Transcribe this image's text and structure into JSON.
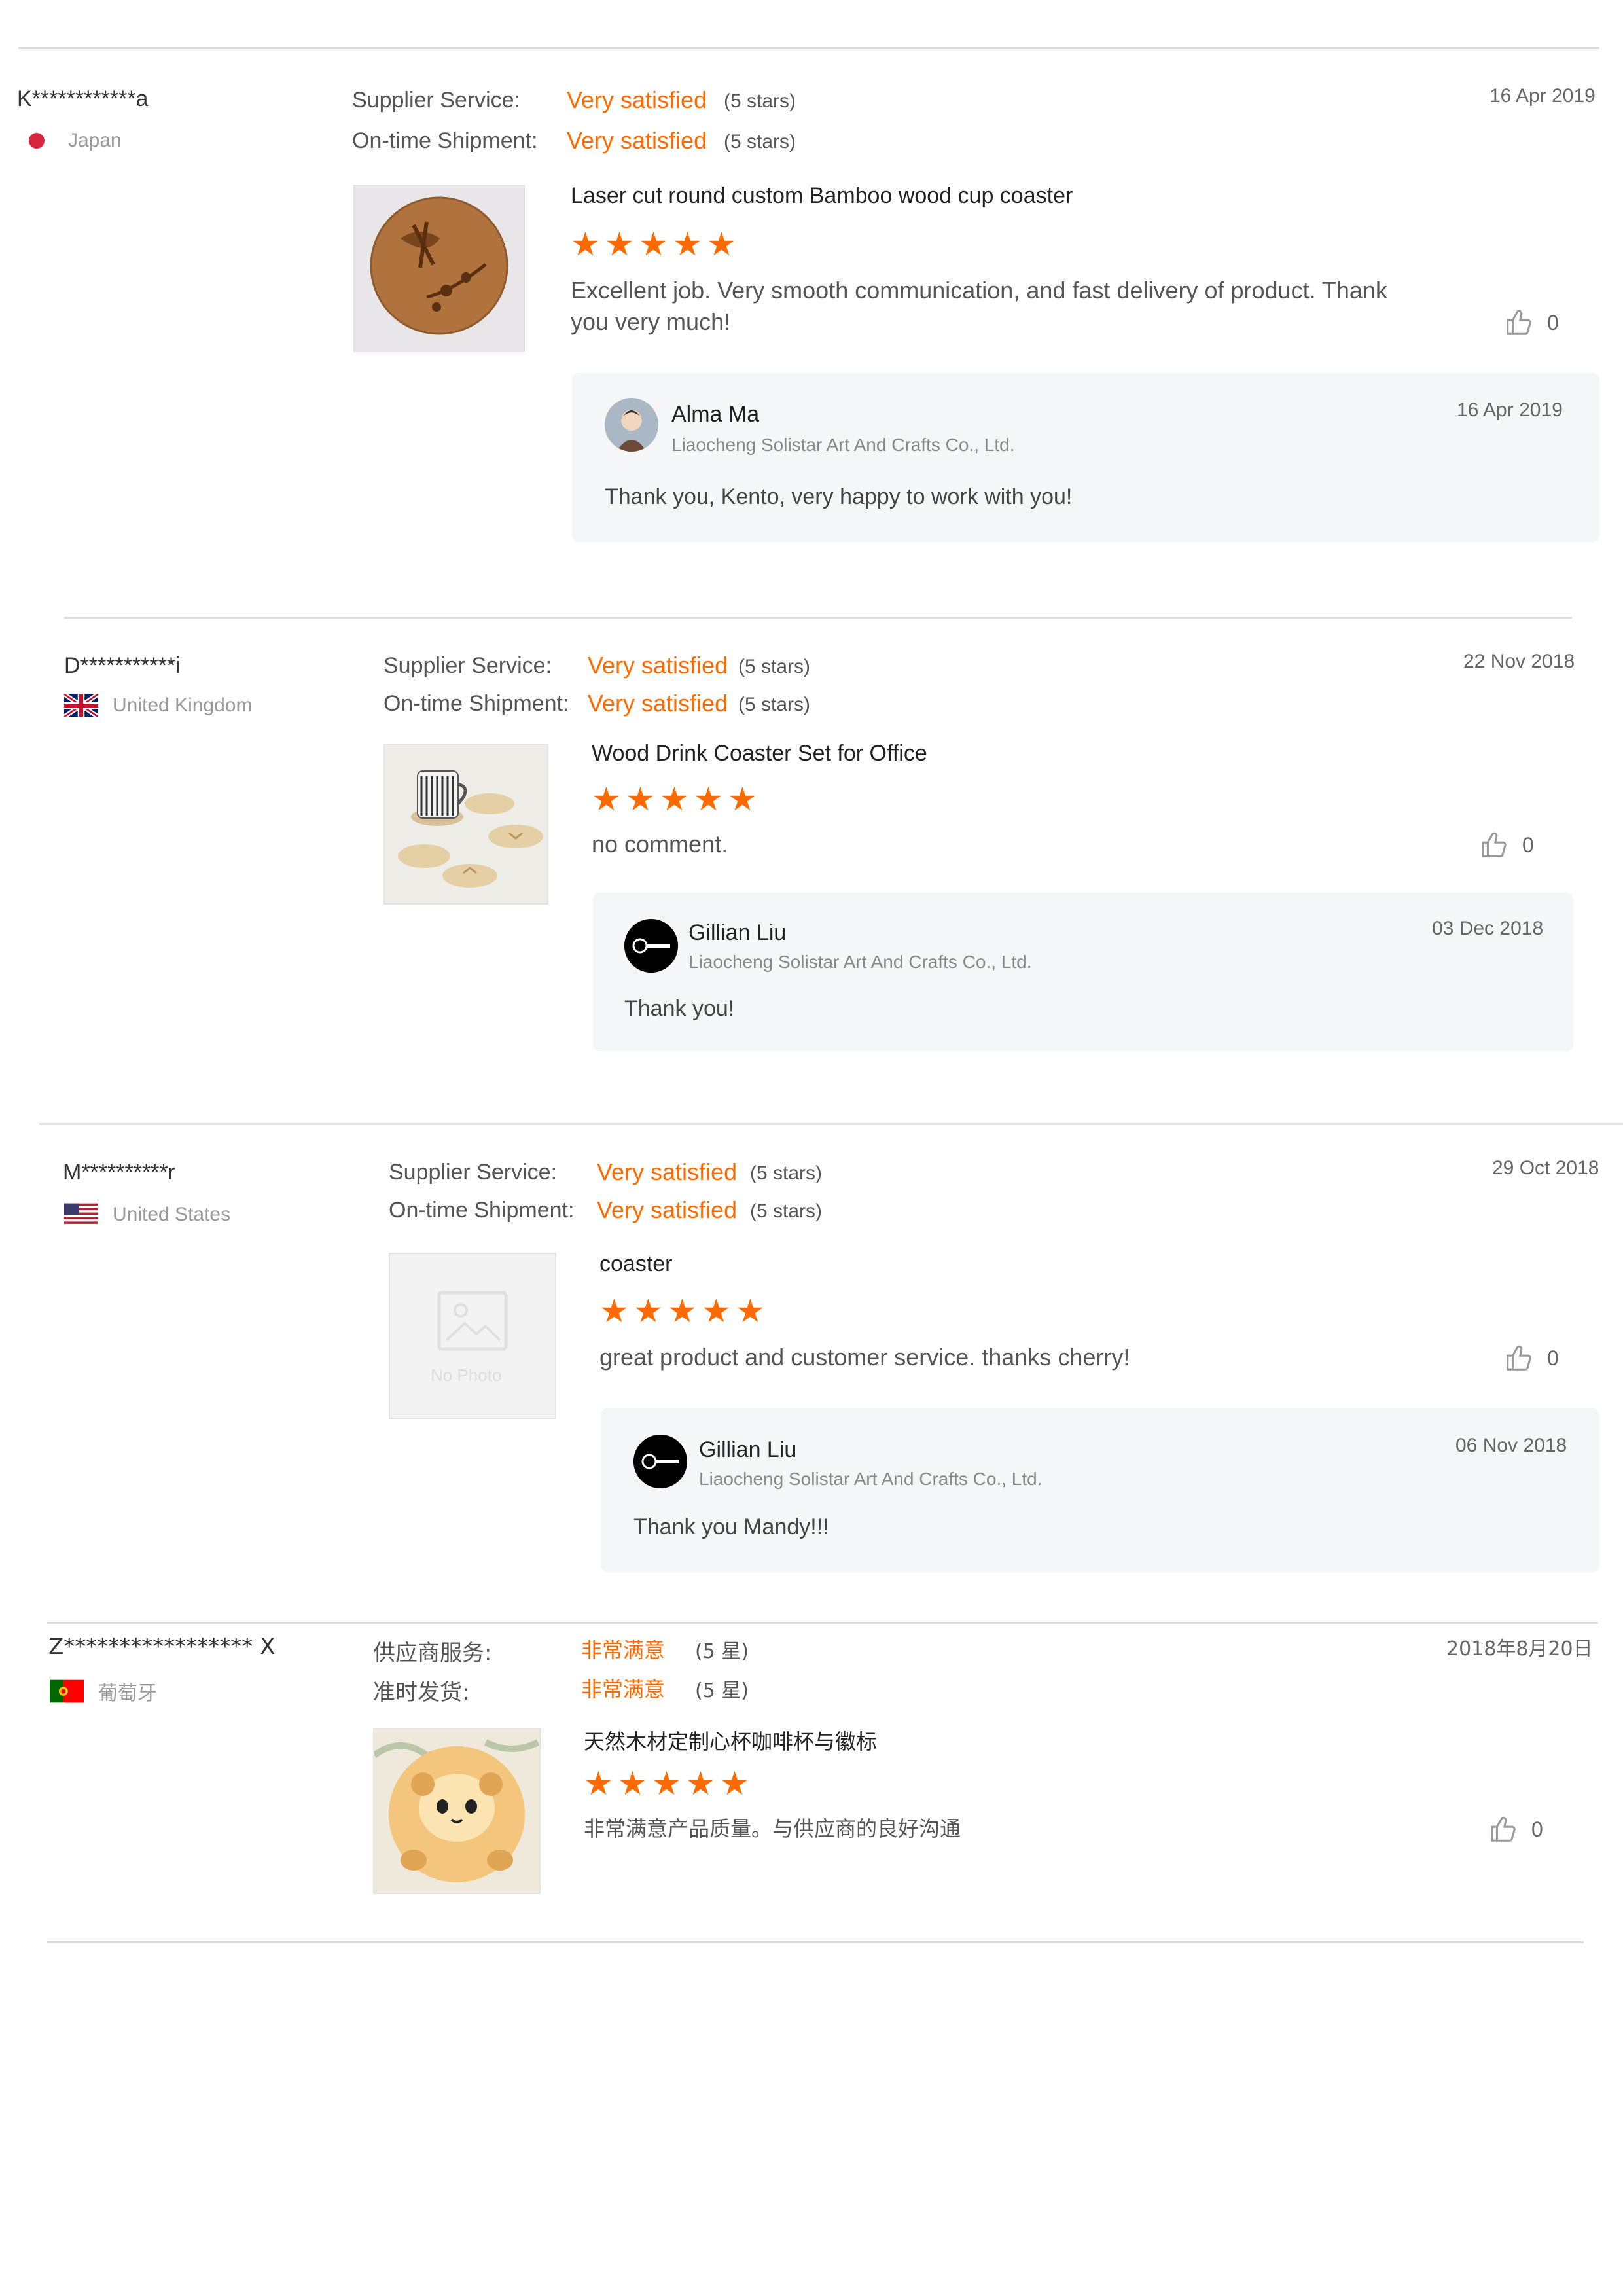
{
  "reviews": [
    {
      "user": "K************a",
      "country": "Japan",
      "supplier_label": "Supplier Service:",
      "supplier_value": "Very satisfied",
      "supplier_stars": "(5 stars)",
      "shipment_label": "On-time Shipment:",
      "shipment_value": "Very satisfied",
      "shipment_stars": "(5 stars)",
      "date": "16 Apr 2019",
      "product_title": "Laser cut round custom Bamboo wood cup coaster",
      "rating": 5,
      "comment": "Excellent job. Very smooth communication, and fast delivery of product. Thank you very much!",
      "likes": "0",
      "reply": {
        "name": "Alma Ma",
        "company": "Liaocheng Solistar Art And Crafts Co., Ltd.",
        "date": "16 Apr 2019",
        "text": "Thank you, Kento, very happy to work with you!"
      }
    },
    {
      "user": "D***********i",
      "country": "United Kingdom",
      "supplier_label": "Supplier Service:",
      "supplier_value": "Very satisfied",
      "supplier_stars": "(5 stars)",
      "shipment_label": "On-time Shipment:",
      "shipment_value": "Very satisfied",
      "shipment_stars": "(5 stars)",
      "date": "22 Nov 2018",
      "product_title": "Wood Drink Coaster Set for Office",
      "rating": 5,
      "comment": "no comment.",
      "likes": "0",
      "reply": {
        "name": "Gillian Liu",
        "company": "Liaocheng Solistar Art And Crafts Co., Ltd.",
        "date": "03 Dec 2018",
        "text": "Thank you!"
      }
    },
    {
      "user": "M**********r",
      "country": "United States",
      "supplier_label": "Supplier Service:",
      "supplier_value": "Very satisfied",
      "supplier_stars": "(5 stars)",
      "shipment_label": "On-time Shipment:",
      "shipment_value": "Very satisfied",
      "shipment_stars": "(5 stars)",
      "date": "29 Oct 2018",
      "product_title": "coaster",
      "no_photo": "No Photo",
      "rating": 5,
      "comment": "great product and customer service. thanks cherry!",
      "likes": "0",
      "reply": {
        "name": "Gillian Liu",
        "company": "Liaocheng Solistar Art And Crafts Co., Ltd.",
        "date": "06 Nov 2018",
        "text": "Thank you Mandy!!!"
      }
    },
    {
      "user": "Z***************** X",
      "country": "葡萄牙",
      "supplier_label": "供应商服务:",
      "supplier_value": "非常满意",
      "supplier_stars": "(5 星)",
      "shipment_label": "准时发货:",
      "shipment_value": "非常满意",
      "shipment_stars": "(5 星)",
      "date": "2018年8月20日",
      "product_title": "天然木材定制心杯咖啡杯与徽标",
      "rating": 5,
      "comment": "非常满意产品质量。与供应商的良好沟通",
      "likes": "0"
    }
  ],
  "colors": {
    "accent": "#ff6a00",
    "divider": "#dcdcdc",
    "reply_bg": "#f5f6f8"
  },
  "icons": {
    "star": "star-icon",
    "like": "thumbs-up-icon",
    "placeholder": "image-placeholder-icon"
  }
}
